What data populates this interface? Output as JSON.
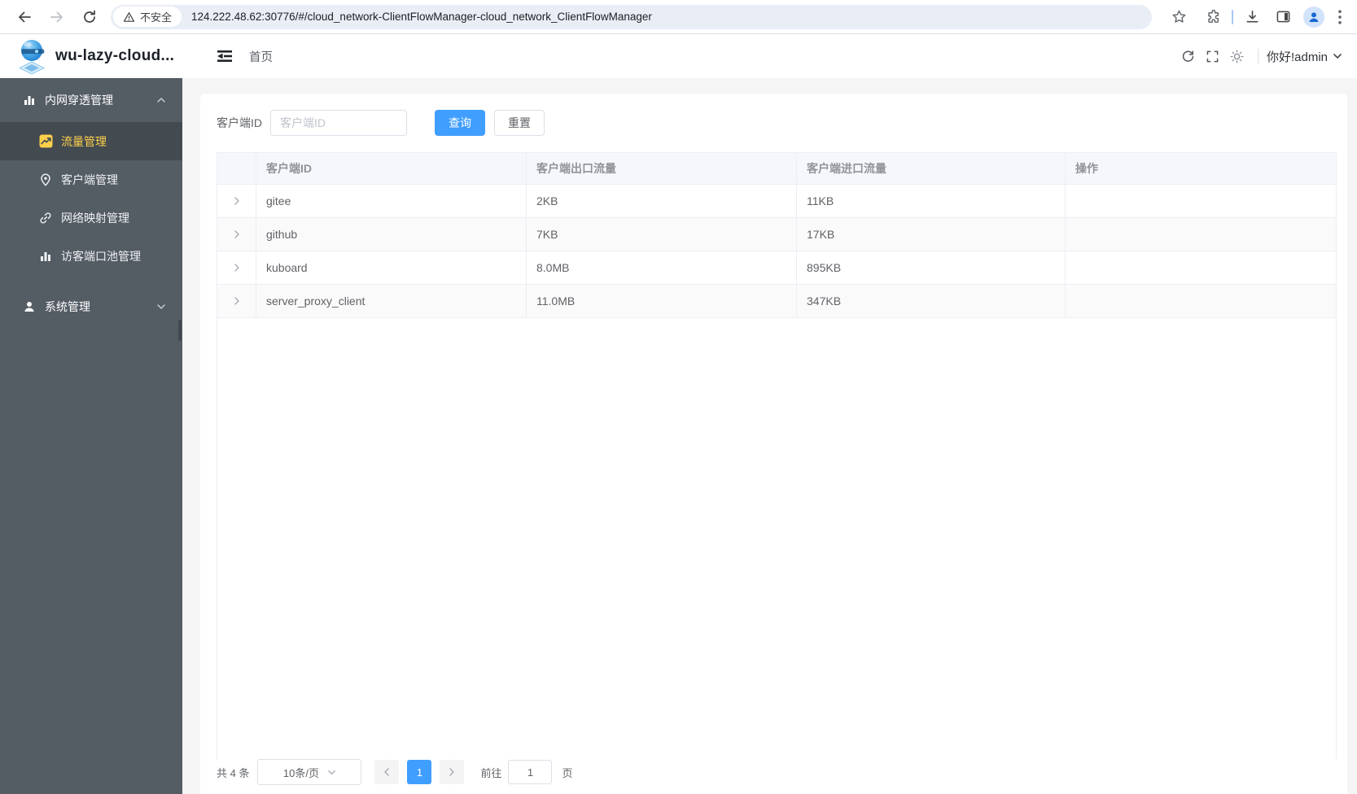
{
  "browser": {
    "security_label": "不安全",
    "url": "124.222.48.62:30776/#/cloud_network-ClientFlowManager-cloud_network_ClientFlowManager"
  },
  "app_header": {
    "title": "wu-lazy-cloud...",
    "breadcrumb": "首页",
    "greeting": "你好!admin"
  },
  "sidebar": {
    "groups": [
      {
        "label": "内网穿透管理",
        "expanded": true,
        "items": [
          {
            "label": "流量管理",
            "active": true
          },
          {
            "label": "客户端管理",
            "active": false
          },
          {
            "label": "网络映射管理",
            "active": false
          },
          {
            "label": "访客端口池管理",
            "active": false
          }
        ]
      },
      {
        "label": "系统管理",
        "expanded": false,
        "items": []
      }
    ]
  },
  "filter": {
    "label": "客户端ID",
    "placeholder": "客户端ID",
    "value": "",
    "query_button": "查询",
    "reset_button": "重置"
  },
  "table": {
    "columns": [
      "客户端ID",
      "客户端出口流量",
      "客户端进口流量",
      "操作"
    ],
    "rows": [
      {
        "client_id": "gitee",
        "outbound": "2KB",
        "inbound": "11KB"
      },
      {
        "client_id": "github",
        "outbound": "7KB",
        "inbound": "17KB"
      },
      {
        "client_id": "kuboard",
        "outbound": "8.0MB",
        "inbound": "895KB"
      },
      {
        "client_id": "server_proxy_client",
        "outbound": "11.0MB",
        "inbound": "347KB"
      }
    ]
  },
  "pagination": {
    "total": "共 4 条",
    "page_size": "10条/页",
    "current_page": "1",
    "goto_label": "前往",
    "goto_value": "1",
    "unit_label": "页"
  },
  "colors": {
    "accent": "#409eff",
    "sidebar_bg": "#545c64",
    "sidebar_active_bg": "#434a50",
    "active_menu_text": "#ffd04b",
    "table_border": "#ebeef5",
    "header_row_bg": "#f5f7fa"
  },
  "icons": {
    "back-icon": "left-arrow",
    "forward-icon": "right-arrow",
    "reload-icon": "circular-arrow",
    "warning-icon": "triangle-exclamation",
    "star-icon": "bookmark-star",
    "extensions-icon": "puzzle-piece",
    "download-icon": "arrow-into-tray",
    "side-panel-icon": "split-rectangle",
    "profile-icon": "person",
    "kebab-menu-icon": "three-dots",
    "fold-icon": "collapse-menu-bars",
    "refresh-icon": "circular-refresh",
    "fullscreen-icon": "corner-brackets",
    "theme-icon": "sun",
    "histogram-icon": "bar-chart",
    "trend-icon": "yellow-trend-chart",
    "pin-icon": "location-pin",
    "link-icon": "chain-link",
    "user-icon": "person",
    "chevron": "angle"
  }
}
